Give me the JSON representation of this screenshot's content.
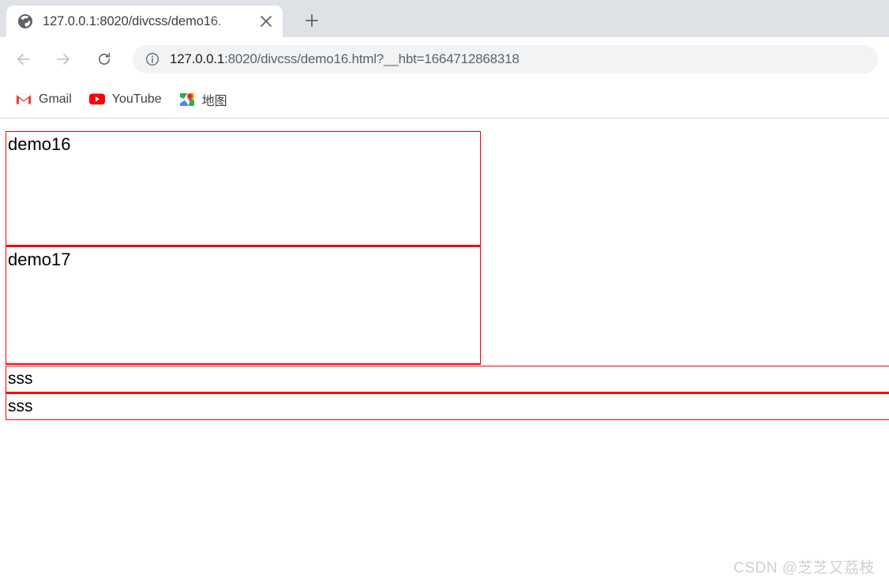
{
  "browser": {
    "tab": {
      "favicon": "globe-icon",
      "title": "127.0.0.1:8020/divcss/demo16.",
      "close_label": "×"
    },
    "new_tab_label": "+",
    "toolbar": {
      "back_icon": "back-arrow-icon",
      "forward_icon": "forward-arrow-icon",
      "reload_icon": "reload-icon",
      "security_icon": "info-circle-icon",
      "url_host": "127.0.0.1",
      "url_rest": ":8020/divcss/demo16.html?__hbt=1664712868318",
      "url_full": "127.0.0.1:8020/divcss/demo16.html?__hbt=1664712868318"
    },
    "bookmarks": [
      {
        "label": "Gmail",
        "icon": "gmail-icon"
      },
      {
        "label": "YouTube",
        "icon": "youtube-icon"
      },
      {
        "label": "地图",
        "icon": "google-maps-icon"
      }
    ]
  },
  "page": {
    "blocks": [
      {
        "text": "demo16"
      },
      {
        "text": "demo17"
      },
      {
        "text": "sss"
      },
      {
        "text": "sss"
      }
    ],
    "border_color": "#ff0000",
    "watermark": "CSDN @芝芝又荔枝"
  }
}
